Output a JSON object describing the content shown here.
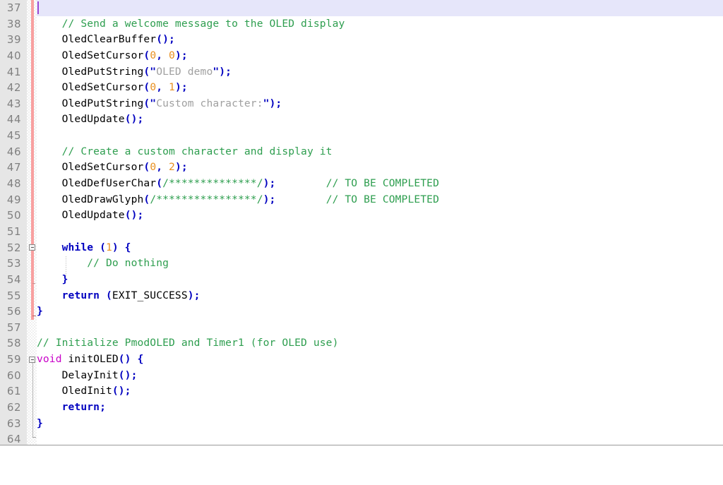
{
  "editor": {
    "first_line": 37,
    "last_line": 64,
    "current_line": 37,
    "language": "C",
    "colors": {
      "background": "#ffffff",
      "gutter": "#e6e6e6",
      "line_number": "#808080",
      "current_line_highlight": "#e6e6fa",
      "caret": "#9a4ad6",
      "change_bar": "#f8a0a0",
      "keyword": "#0000c0",
      "type": "#c800c8",
      "comment": "#2e9e4f",
      "string": "#a0a0a0",
      "number": "#e89020",
      "punctuation": "#0000c0"
    }
  },
  "lines": [
    {
      "n": "37",
      "text": "",
      "current": true
    },
    {
      "n": "38",
      "text": "    // Send a welcome message to the OLED display"
    },
    {
      "n": "39",
      "text": "    OledClearBuffer();"
    },
    {
      "n": "40",
      "text": "    OledSetCursor(0, 0);"
    },
    {
      "n": "41",
      "text": "    OledPutString(\"OLED demo\");"
    },
    {
      "n": "42",
      "text": "    OledSetCursor(0, 1);"
    },
    {
      "n": "43",
      "text": "    OledPutString(\"Custom character:\");"
    },
    {
      "n": "44",
      "text": "    OledUpdate();"
    },
    {
      "n": "45",
      "text": ""
    },
    {
      "n": "46",
      "text": "    // Create a custom character and display it"
    },
    {
      "n": "47",
      "text": "    OledSetCursor(0, 2);"
    },
    {
      "n": "48",
      "text": "    OledDefUserChar(/**************/);        // TO BE COMPLETED"
    },
    {
      "n": "49",
      "text": "    OledDrawGlyph(/****************/);        // TO BE COMPLETED"
    },
    {
      "n": "50",
      "text": "    OledUpdate();"
    },
    {
      "n": "51",
      "text": ""
    },
    {
      "n": "52",
      "text": "    while (1) {"
    },
    {
      "n": "53",
      "text": "        // Do nothing"
    },
    {
      "n": "54",
      "text": "    }"
    },
    {
      "n": "55",
      "text": "    return (EXIT_SUCCESS);"
    },
    {
      "n": "56",
      "text": "}"
    },
    {
      "n": "57",
      "text": ""
    },
    {
      "n": "58",
      "text": "// Initialize PmodOLED and Timer1 (for OLED use)"
    },
    {
      "n": "59",
      "text": "void initOLED() {"
    },
    {
      "n": "60",
      "text": "    DelayInit();"
    },
    {
      "n": "61",
      "text": "    OledInit();"
    },
    {
      "n": "62",
      "text": "    return;"
    },
    {
      "n": "63",
      "text": "}"
    },
    {
      "n": "64",
      "text": ""
    }
  ],
  "tokens": {
    "l38": [
      [
        "cmt",
        "    // Send a welcome message to the OLED display"
      ]
    ],
    "l39": [
      [
        "id",
        "    OledClearBuffer"
      ],
      [
        "pun",
        "();"
      ]
    ],
    "l40": [
      [
        "id",
        "    OledSetCursor"
      ],
      [
        "pun",
        "("
      ],
      [
        "num",
        "0"
      ],
      [
        "pun",
        ","
      ],
      [
        "id",
        " "
      ],
      [
        "num",
        "0"
      ],
      [
        "pun",
        ");"
      ]
    ],
    "l41": [
      [
        "id",
        "    OledPutString"
      ],
      [
        "pun",
        "(\""
      ],
      [
        "str",
        "OLED demo"
      ],
      [
        "pun",
        "\");"
      ]
    ],
    "l42": [
      [
        "id",
        "    OledSetCursor"
      ],
      [
        "pun",
        "("
      ],
      [
        "num",
        "0"
      ],
      [
        "pun",
        ","
      ],
      [
        "id",
        " "
      ],
      [
        "num",
        "1"
      ],
      [
        "pun",
        ");"
      ]
    ],
    "l43": [
      [
        "id",
        "    OledPutString"
      ],
      [
        "pun",
        "(\""
      ],
      [
        "str",
        "Custom character:"
      ],
      [
        "pun",
        "\");"
      ]
    ],
    "l44": [
      [
        "id",
        "    OledUpdate"
      ],
      [
        "pun",
        "();"
      ]
    ],
    "l46": [
      [
        "cmt",
        "    // Create a custom character and display it"
      ]
    ],
    "l47": [
      [
        "id",
        "    OledSetCursor"
      ],
      [
        "pun",
        "("
      ],
      [
        "num",
        "0"
      ],
      [
        "pun",
        ","
      ],
      [
        "id",
        " "
      ],
      [
        "num",
        "2"
      ],
      [
        "pun",
        ");"
      ]
    ],
    "l48": [
      [
        "id",
        "    OledDefUserChar"
      ],
      [
        "pun",
        "("
      ],
      [
        "star",
        "/**************/"
      ],
      [
        "pun",
        ");"
      ],
      [
        "id",
        "        "
      ],
      [
        "cmt",
        "// TO BE COMPLETED"
      ]
    ],
    "l49": [
      [
        "id",
        "    OledDrawGlyph"
      ],
      [
        "pun",
        "("
      ],
      [
        "star",
        "/****************/"
      ],
      [
        "pun",
        ");"
      ],
      [
        "id",
        "        "
      ],
      [
        "cmt",
        "// TO BE COMPLETED"
      ]
    ],
    "l50": [
      [
        "id",
        "    OledUpdate"
      ],
      [
        "pun",
        "();"
      ]
    ],
    "l52": [
      [
        "kw",
        "    while"
      ],
      [
        "id",
        " "
      ],
      [
        "pun",
        "("
      ],
      [
        "num",
        "1"
      ],
      [
        "pun",
        ") {"
      ]
    ],
    "l53": [
      [
        "cmt",
        "        // Do nothing"
      ]
    ],
    "l54": [
      [
        "blk",
        "    }"
      ]
    ],
    "l55": [
      [
        "kw",
        "    return"
      ],
      [
        "id",
        " "
      ],
      [
        "pun",
        "("
      ],
      [
        "id",
        "EXIT_SUCCESS"
      ],
      [
        "pun",
        ");"
      ]
    ],
    "l56": [
      [
        "blk",
        "}"
      ]
    ],
    "l58": [
      [
        "cmt",
        "// Initialize PmodOLED and Timer1 (for OLED use)"
      ]
    ],
    "l59": [
      [
        "typ",
        "void"
      ],
      [
        "id",
        " initOLED"
      ],
      [
        "pun",
        "() {"
      ]
    ],
    "l60": [
      [
        "id",
        "    DelayInit"
      ],
      [
        "pun",
        "();"
      ]
    ],
    "l61": [
      [
        "id",
        "    OledInit"
      ],
      [
        "pun",
        "();"
      ]
    ],
    "l62": [
      [
        "kw",
        "    return"
      ],
      [
        "pun",
        ";"
      ]
    ],
    "l63": [
      [
        "blk",
        "}"
      ]
    ]
  }
}
